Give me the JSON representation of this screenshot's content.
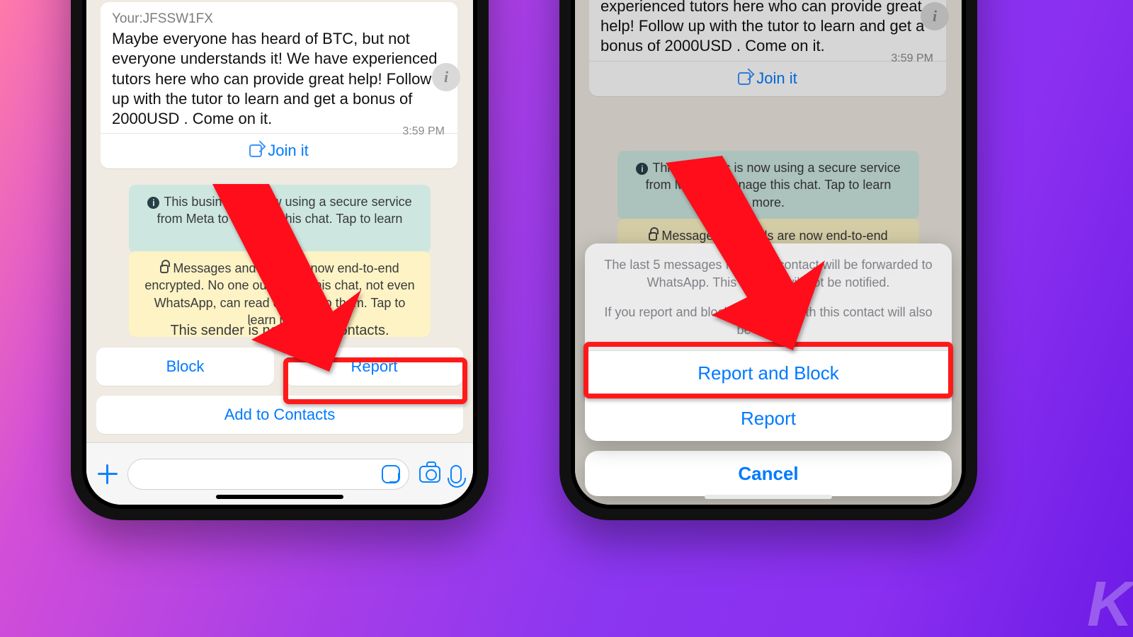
{
  "left": {
    "message": {
      "code": "Your:JFSSW1FX",
      "body": "Maybe everyone has heard of BTC, but not everyone understands it! We have experienced tutors here who can provide great help! Follow up with the tutor to learn and get a bonus of 2000USD . Come on it.",
      "time": "3:59 PM",
      "join": "Join it"
    },
    "banner_teal": "This business is now using a secure service from Meta to manage this chat. Tap to learn more.",
    "banner_yellow": "Messages and calls are now end-to-end encrypted. No one outside of this chat, not even WhatsApp, can read or listen to them. Tap to learn more.",
    "unknown_title": "This sender is not in your contacts.",
    "block": "Block",
    "report": "Report",
    "add": "Add to Contacts"
  },
  "right": {
    "message": {
      "body": "but not everyone understands it! We have experienced tutors here who can provide great help! Follow up with the tutor to learn and get a bonus of 2000USD . Come on it.",
      "time": "3:59 PM",
      "join": "Join it"
    },
    "banner_teal": "This business is now using a secure service from Meta to manage this chat. Tap to learn more.",
    "banner_yellow": "Messages and calls are now end-to-end encrypted. No one outside of this chat, not even WhatsApp, can read or listen to them. Tap to learn more.",
    "sheet": {
      "line1": "The last 5 messages from this contact will be forwarded to WhatsApp. This contact will not be notified.",
      "line2": "If you report and block, your chat with this contact will also be deleted.",
      "report_block": "Report and Block",
      "report": "Report",
      "cancel": "Cancel"
    }
  }
}
